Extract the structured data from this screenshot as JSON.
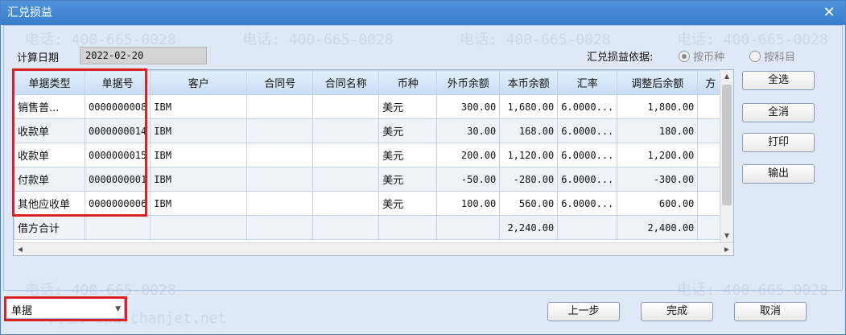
{
  "window": {
    "title": "汇兑损益",
    "close_glyph": "✕"
  },
  "form": {
    "date_label": "计算日期",
    "date_value": "2022-02-20"
  },
  "basis": {
    "label": "汇兑损益依据:",
    "options": [
      "按币种",
      "按科目"
    ],
    "selected": "按币种"
  },
  "table": {
    "headers": [
      "单据类型",
      "单据号",
      "客户",
      "合同号",
      "合同名称",
      "币种",
      "外币余额",
      "本币余额",
      "汇率",
      "调整后余额",
      "方"
    ],
    "rows": [
      [
        "销售普...",
        "0000000008",
        "IBM",
        "",
        "",
        "美元",
        "300.00",
        "1,680.00",
        "6.0000...",
        "1,800.00",
        ""
      ],
      [
        "收款单",
        "0000000014",
        "IBM",
        "",
        "",
        "美元",
        "30.00",
        "168.00",
        "6.0000...",
        "180.00",
        ""
      ],
      [
        "收款单",
        "0000000015",
        "IBM",
        "",
        "",
        "美元",
        "200.00",
        "1,120.00",
        "6.0000...",
        "1,200.00",
        ""
      ],
      [
        "付款单",
        "0000000001",
        "IBM",
        "",
        "",
        "美元",
        "-50.00",
        "-280.00",
        "6.0000...",
        "-300.00",
        ""
      ],
      [
        "其他应收单",
        "0000000006",
        "IBM",
        "",
        "",
        "美元",
        "100.00",
        "560.00",
        "6.0000...",
        "600.00",
        ""
      ],
      [
        "借方合计",
        "",
        "",
        "",
        "",
        "",
        "",
        "2,240.00",
        "",
        "2,400.00",
        ""
      ]
    ]
  },
  "side_buttons": {
    "select_all": "全选",
    "deselect_all": "全消",
    "print": "打印",
    "export": "输出"
  },
  "bottom": {
    "combo_value": "单据",
    "prev": "上一步",
    "finish": "完成",
    "cancel": "取消"
  },
  "watermark": {
    "phone": "电话: 400-665-0028",
    "site": "网址: www.chanjet.net"
  },
  "colors": {
    "highlight": "#e02020",
    "title_bar": "#3a7dcc"
  }
}
